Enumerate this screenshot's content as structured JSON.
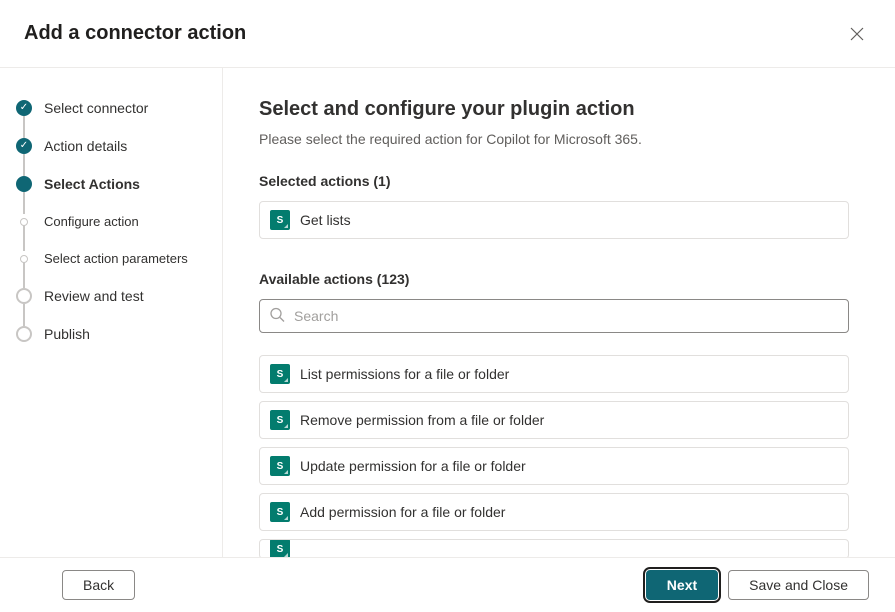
{
  "header": {
    "title": "Add a connector action"
  },
  "steps": [
    {
      "label": "Select connector",
      "state": "completed"
    },
    {
      "label": "Action details",
      "state": "completed"
    },
    {
      "label": "Select Actions",
      "state": "current"
    },
    {
      "label": "Configure action",
      "state": "sub"
    },
    {
      "label": "Select action parameters",
      "state": "sub"
    },
    {
      "label": "Review and test",
      "state": "hollow"
    },
    {
      "label": "Publish",
      "state": "hollow"
    }
  ],
  "main": {
    "heading": "Select and configure your plugin action",
    "subtext": "Please select the required action for Copilot for Microsoft 365.",
    "selected_label": "Selected actions (1)",
    "available_label": "Available actions (123)",
    "search_placeholder": "Search"
  },
  "selected_actions": [
    {
      "label": "Get lists"
    }
  ],
  "available_actions": [
    {
      "label": "List permissions for a file or folder"
    },
    {
      "label": "Remove permission from a file or folder"
    },
    {
      "label": "Update permission for a file or folder"
    },
    {
      "label": "Add permission for a file or folder"
    }
  ],
  "footer": {
    "back": "Back",
    "next": "Next",
    "save_close": "Save and Close"
  }
}
